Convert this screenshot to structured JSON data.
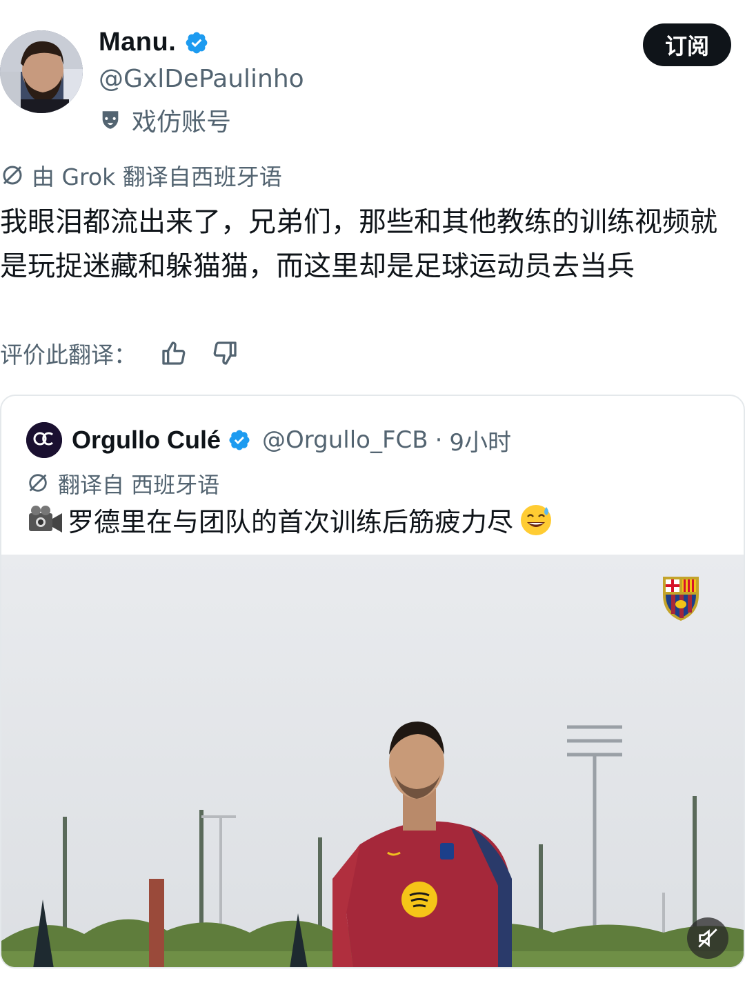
{
  "author": {
    "display_name": "Manu.",
    "handle": "@GxlDePaulinho",
    "parody_label": "戏仿账号",
    "subscribe_label": "订阅"
  },
  "translation": {
    "grok_label": "由 Grok 翻译自西班牙语",
    "rate_label": "评价此翻译："
  },
  "tweet": {
    "text": "我眼泪都流出来了，兄弟们，那些和其他教练的训练视频就是玩捉迷藏和躲猫猫，而这里却是足球运动员去当兵"
  },
  "quoted": {
    "display_name": "Orgullo Culé",
    "handle": "@Orgullo_FCB",
    "separator": "·",
    "time": "9小时",
    "translate_label": "翻译自 西班牙语",
    "text": "罗德里在与团队的首次训练后筋疲力尽"
  },
  "icons": {
    "verified": "verified-badge-icon",
    "parody": "parody-mask-icon",
    "translate": "translate-icon",
    "thumbs_up": "thumbs-up-icon",
    "thumbs_down": "thumbs-down-icon",
    "camera": "video-camera-icon",
    "sweat": "sweat-smile-emoji-icon",
    "mute": "muted-speaker-icon"
  },
  "colors": {
    "verified": "#1d9bf0",
    "text_primary": "#0f1419",
    "text_secondary": "#536471",
    "subscribe_bg": "#0f1419"
  }
}
